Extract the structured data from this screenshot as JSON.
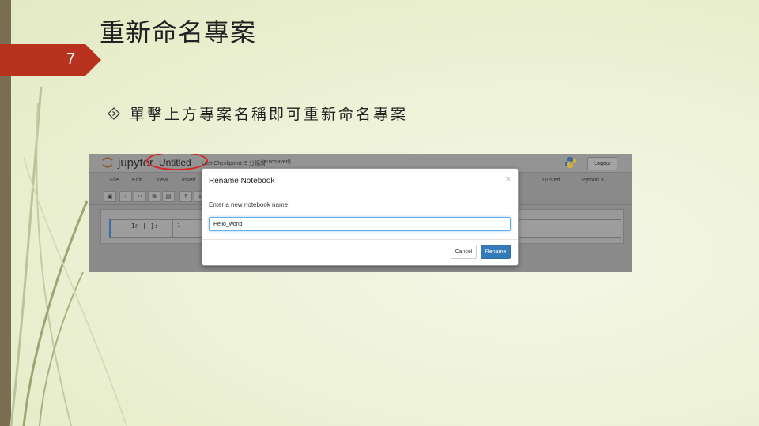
{
  "slide": {
    "title": "重新命名專案",
    "number": "7",
    "bullet": "單擊上方專案名稱即可重新命名專案"
  },
  "jupyter": {
    "logo_text": "jupyter",
    "notebook_title": "Untitled",
    "checkpoint": "Last Checkpoint: 5 分鐘前",
    "autosaved": "(autosaved)",
    "logout": "Logout",
    "menu": [
      "File",
      "Edit",
      "View",
      "Insert"
    ],
    "trusted": "Trusted",
    "kernel": "Python 3",
    "toolbar_icons": [
      "save-icon",
      "plus-icon",
      "cut-icon",
      "copy-icon",
      "paste-icon",
      "arrow-up-icon",
      "arrow-down-icon"
    ],
    "cell_prompt": "In [ ]:",
    "cell_line_number": "1"
  },
  "modal": {
    "title": "Rename Notebook",
    "close": "×",
    "label": "Enter a new notebook name:",
    "input_value": "Hello_world",
    "cancel": "Cancel",
    "rename": "Rename"
  },
  "colors": {
    "accent_red": "#b8321d",
    "highlight_circle": "#d7261d",
    "primary_button": "#337ab7",
    "left_bar": "#7a6e52"
  }
}
